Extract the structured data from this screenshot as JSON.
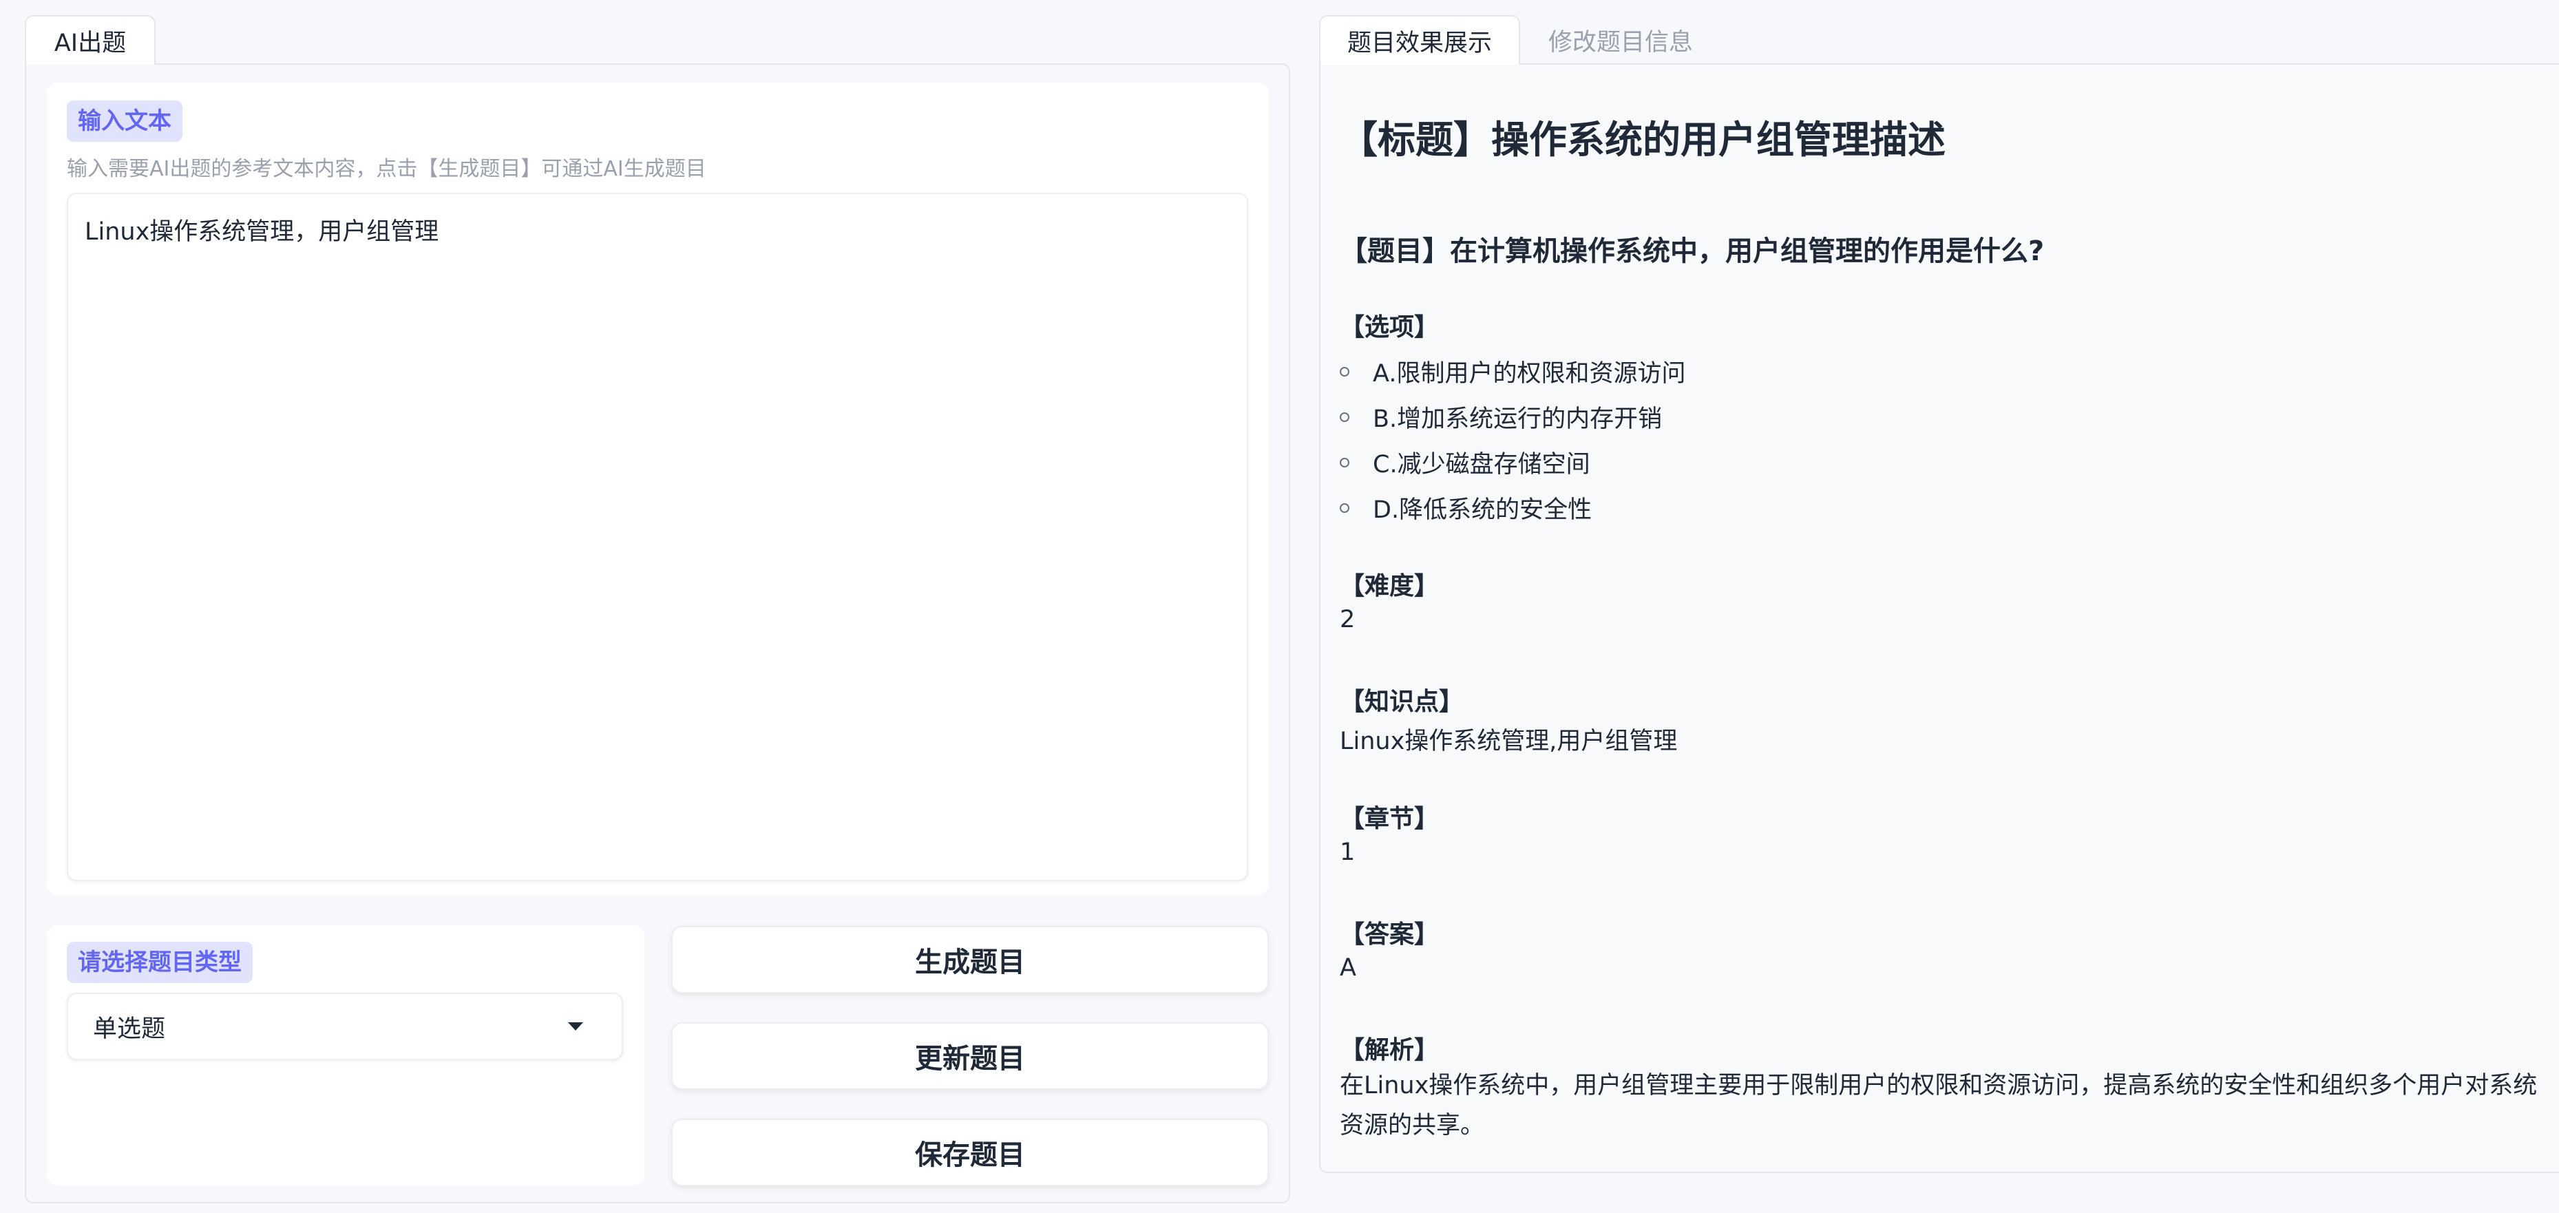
{
  "left_tabs": [
    {
      "label": "AI出题",
      "active": true
    }
  ],
  "right_tabs": [
    {
      "label": "题目效果展示",
      "active": true
    },
    {
      "label": "修改题目信息",
      "active": false
    }
  ],
  "input_section": {
    "label": "输入文本",
    "hint": "输入需要AI出题的参考文本内容，点击【生成题目】可通过AI生成题目",
    "value": "Linux操作系统管理，用户组管理"
  },
  "type_section": {
    "label": "请选择题目类型",
    "selected": "单选题"
  },
  "buttons": {
    "generate": "生成题目",
    "update": "更新题目",
    "save": "保存题目"
  },
  "question": {
    "title": "【标题】操作系统的用户组管理描述",
    "stem": "【题目】在计算机操作系统中，用户组管理的作用是什么?",
    "options_label": "【选项】",
    "options": [
      "A.限制用户的权限和资源访问",
      "B.增加系统运行的内存开销",
      "C.减少磁盘存储空间",
      "D.降低系统的安全性"
    ],
    "difficulty_label": "【难度】",
    "difficulty": "2",
    "knowledge_label": "【知识点】",
    "knowledge": "Linux操作系统管理,用户组管理",
    "chapter_label": "【章节】",
    "chapter": "1",
    "answer_label": "【答案】",
    "answer": "A",
    "analysis_label": "【解析】",
    "analysis": "在Linux操作系统中，用户组管理主要用于限制用户的权限和资源访问，提高系统的安全性和组织多个用户对系统资源的共享。"
  },
  "colors": {
    "accent": "#6366f1",
    "chip_bg": "#e0e3fb",
    "muted": "#9aa1ad",
    "text": "#1f2937"
  }
}
